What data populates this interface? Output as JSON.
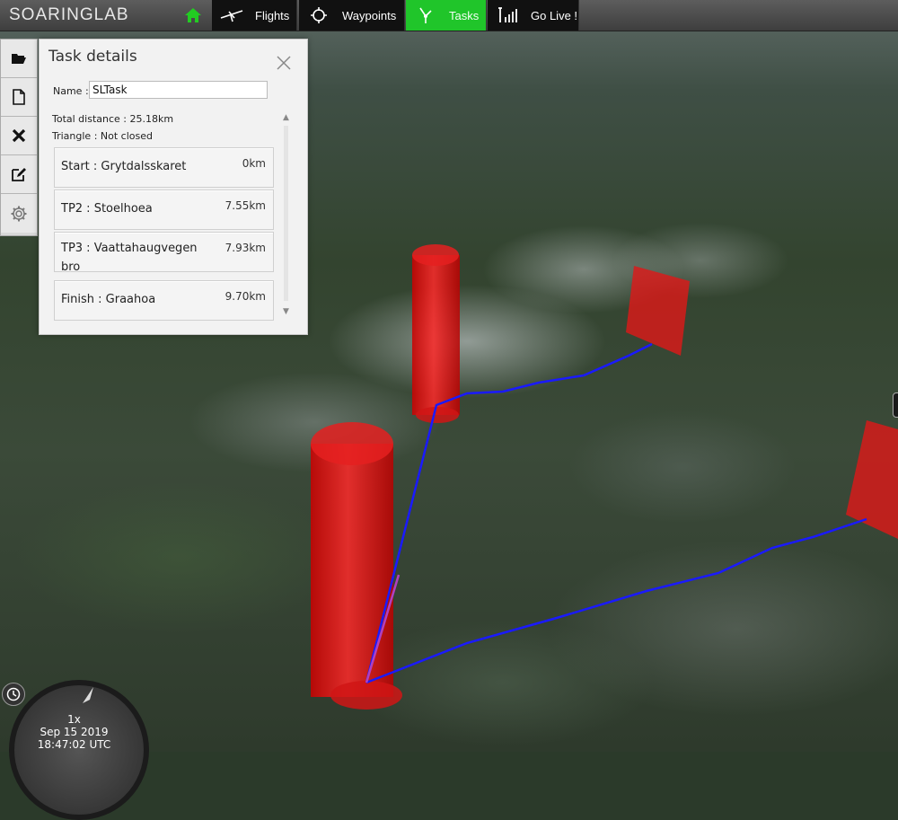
{
  "app": {
    "logo": "SOARINGLAB"
  },
  "nav": {
    "home_icon": "home-icon",
    "items": [
      {
        "label": "Flights",
        "icon": "glider-icon"
      },
      {
        "label": "Waypoints",
        "icon": "crosshair-icon"
      },
      {
        "label": "Tasks",
        "icon": "task-route-icon",
        "active": true
      },
      {
        "label": "Go Live !",
        "icon": "signal-antenna-icon"
      }
    ],
    "active_color": "#20c52a"
  },
  "sidebar": {
    "buttons": [
      {
        "icon": "folder-open-icon"
      },
      {
        "icon": "new-file-icon"
      },
      {
        "icon": "close-x-icon"
      },
      {
        "icon": "edit-icon"
      },
      {
        "icon": "gear-icon"
      }
    ]
  },
  "task_panel": {
    "title": "Task details",
    "name_label": "Name :",
    "name_value": "SLTask",
    "total_distance": "Total distance : 25.18km",
    "triangle": "Triangle : Not closed",
    "turnpoints": [
      {
        "name": "Start : Grytdalsskaret",
        "distance": "0km"
      },
      {
        "name": "TP2 : Stoelhoea",
        "distance": "7.55km"
      },
      {
        "name": "TP3 : Vaattahaugvegen bro",
        "distance": "7.93km"
      },
      {
        "name": "Finish : Graahoa",
        "distance": "9.70km"
      }
    ]
  },
  "map": {
    "cylinder_color": "#e01818",
    "route_color": "#1a1aff"
  },
  "time": {
    "speed": "1x",
    "date": "Sep 15 2019",
    "utc": "18:47:02 UTC"
  }
}
